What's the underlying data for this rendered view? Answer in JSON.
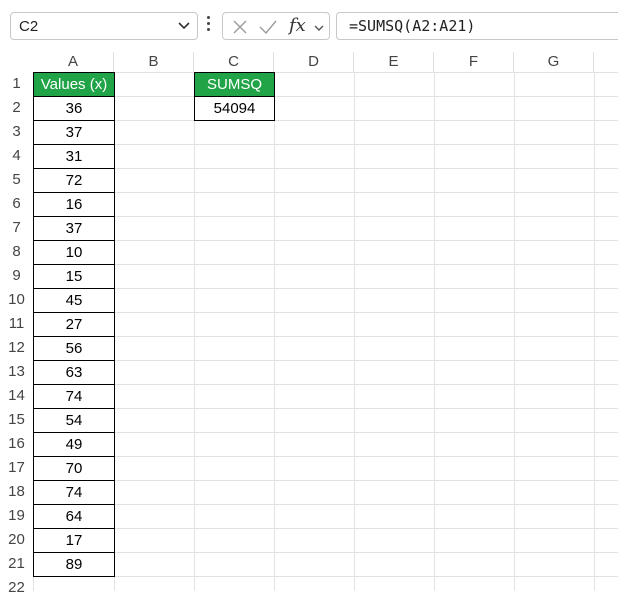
{
  "formula_bar": {
    "name_box": "C2",
    "fx_label": "fx",
    "formula": "=SUMSQ(A2:A21)"
  },
  "columns": [
    "A",
    "B",
    "C",
    "D",
    "E",
    "F",
    "G"
  ],
  "rows": [
    "1",
    "2",
    "3",
    "4",
    "5",
    "6",
    "7",
    "8",
    "9",
    "10",
    "11",
    "12",
    "13",
    "14",
    "15",
    "16",
    "17",
    "18",
    "19",
    "20",
    "21",
    "22"
  ],
  "sheet": {
    "a1_header": "Values (x)",
    "values": [
      "36",
      "37",
      "31",
      "72",
      "16",
      "37",
      "10",
      "15",
      "45",
      "27",
      "56",
      "63",
      "74",
      "54",
      "49",
      "70",
      "74",
      "64",
      "17",
      "89"
    ],
    "c1_header": "SUMSQ",
    "c2_result": "54094"
  },
  "colors": {
    "header_green": "#21a447",
    "header_text": "#ffffff",
    "gridline": "#e2e2e2"
  }
}
